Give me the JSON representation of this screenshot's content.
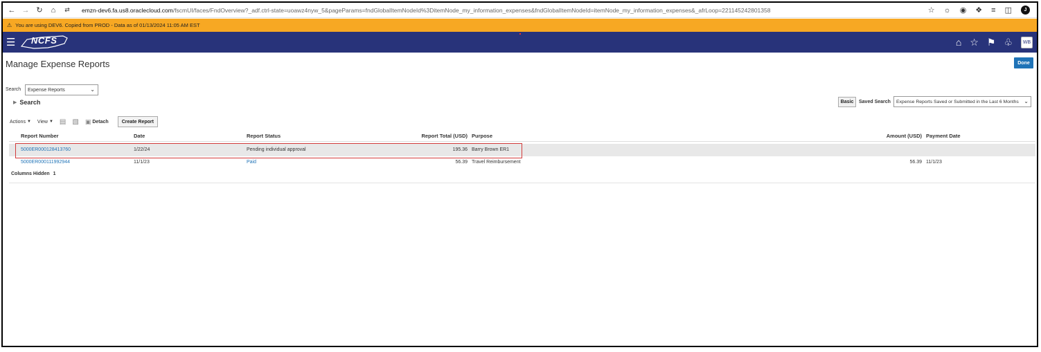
{
  "browser": {
    "url_host": "emzn-dev6.fa.us8.oraclecloud.com",
    "url_path": "/fscmUI/faces/FndOverview?_adf.ctrl-state=uoawz4nyw_5&pageParams=fndGlobalItemNodeId%3DitemNode_my_information_expenses&fndGlobalItemNodeId=itemNode_my_information_expenses&_afrLoop=221145242801358",
    "profile_initial": "J"
  },
  "banner": {
    "text": "You are using DEV6. Copied from PROD - Data as of 01/13/2024 11:05 AM EST"
  },
  "header": {
    "logo_text": "NCFS",
    "avatar_initials": "WB"
  },
  "page": {
    "title": "Manage Expense Reports",
    "done_label": "Done"
  },
  "search": {
    "label": "Search",
    "selected_value": "Expense Reports",
    "toggle_label": "Search",
    "basic_label": "Basic",
    "saved_search_label": "Saved Search",
    "saved_search_value": "Expense Reports Saved or Submitted in the Last 6 Months"
  },
  "toolbar": {
    "actions_label": "Actions",
    "view_label": "View",
    "detach_label": "Detach",
    "create_report_label": "Create Report"
  },
  "table": {
    "headers": {
      "report_number": "Report Number",
      "date": "Date",
      "report_status": "Report Status",
      "report_total": "Report Total (USD)",
      "purpose": "Purpose",
      "amount": "Amount (USD)",
      "payment_date": "Payment Date"
    },
    "rows": [
      {
        "report_number": "5000ER000128413760",
        "date": "1/22/24",
        "status": "Pending individual approval",
        "total": "195.36",
        "purpose": "Barry Brown ER1",
        "amount": "",
        "payment_date": ""
      },
      {
        "report_number": "5000ER000111992944",
        "date": "11/1/23",
        "status": "Paid",
        "total": "56.39",
        "purpose": "Travel Reimbursement",
        "amount": "56.39",
        "payment_date": "11/1/23"
      }
    ],
    "columns_hidden_label": "Columns Hidden",
    "columns_hidden_count": "1"
  },
  "colors": {
    "header_bg": "#28337a",
    "banner_bg": "#f7a823",
    "link": "#1f73b7",
    "highlight": "#d23a3a"
  }
}
